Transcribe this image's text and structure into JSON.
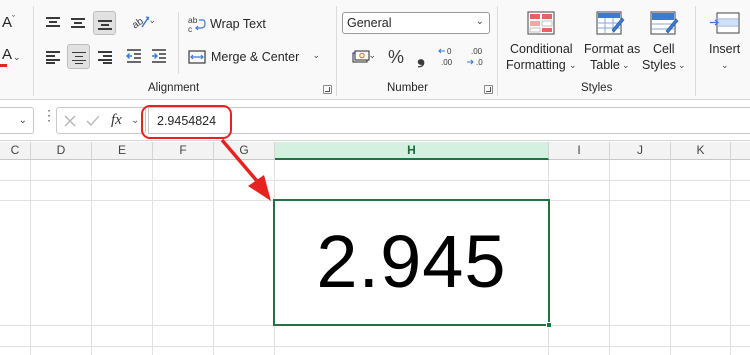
{
  "ribbon": {
    "font_size_glyph": "A",
    "font_color_glyph": "A",
    "alignment": {
      "wrap_text": "Wrap Text",
      "merge_center": "Merge & Center",
      "group_label": "Alignment"
    },
    "number": {
      "format_value": "General",
      "percent_glyph": "%",
      "comma_glyph": "❟",
      "increase_decimal": "←0 .00",
      "decrease_decimal": ".00 →0",
      "group_label": "Number"
    },
    "styles": {
      "conditional_formatting_line1": "Conditional",
      "conditional_formatting_line2": "Formatting",
      "format_as_table_line1": "Format as",
      "format_as_table_line2": "Table",
      "cell_styles_line1": "Cell",
      "cell_styles_line2": "Styles",
      "group_label": "Styles"
    },
    "cells": {
      "insert": "Insert"
    }
  },
  "formula_bar": {
    "fx_label": "fx",
    "value": "2.9454824"
  },
  "grid": {
    "columns": [
      "C",
      "D",
      "E",
      "F",
      "G",
      "H",
      "I",
      "J",
      "K"
    ],
    "selected_column": "H",
    "selected_cell_display": "2.945"
  },
  "colors": {
    "accent_green": "#217346",
    "callout_red": "#e8231f"
  }
}
